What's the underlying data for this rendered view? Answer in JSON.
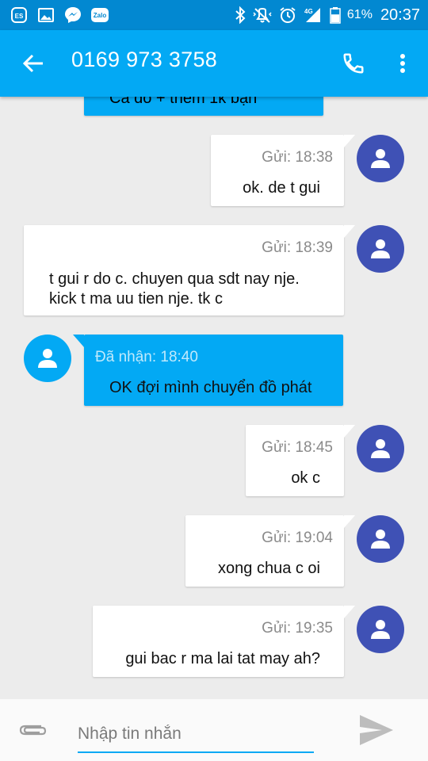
{
  "status_bar": {
    "apps": [
      "es-file-explorer-icon",
      "gallery-icon",
      "messenger-icon",
      "zalo-icon"
    ],
    "zalo_text": "Zalo",
    "es_text": "ES",
    "network": "4G",
    "battery_percent": "61%",
    "battery_level": 0.61,
    "time": "20:37"
  },
  "app_bar": {
    "title": "0169 973 3758",
    "color": "#03a9f4"
  },
  "messages": {
    "partial_top": "Ca do + them 1k bạn",
    "m1": {
      "type": "sent",
      "meta": "Gửi: 18:38",
      "lines": [
        "ok. de t gui"
      ]
    },
    "m2": {
      "type": "sent",
      "meta": "Gửi: 18:39",
      "lines": [
        "t gui r do c. chuyen qua sdt nay nje.",
        "kick t ma uu tien nje. tk c"
      ]
    },
    "m3": {
      "type": "received",
      "meta": "Đã nhận: 18:40",
      "lines": [
        "OK đợi mình chuyển đồ phát"
      ]
    },
    "m4": {
      "type": "sent",
      "meta": "Gửi: 18:45",
      "lines": [
        "ok c"
      ]
    },
    "m5": {
      "type": "sent",
      "meta": "Gửi: 19:04",
      "lines": [
        "xong chua c oi"
      ]
    },
    "m6": {
      "type": "sent",
      "meta": "Gửi: 19:35",
      "lines": [
        "gui bac r ma lai tat may ah?"
      ]
    }
  },
  "composer": {
    "placeholder": "Nhập tin nhắn"
  },
  "colors": {
    "status_bar": "#0288d1",
    "accent": "#03a9f4",
    "sent_avatar": "#3f51b5",
    "background": "#ececec"
  }
}
